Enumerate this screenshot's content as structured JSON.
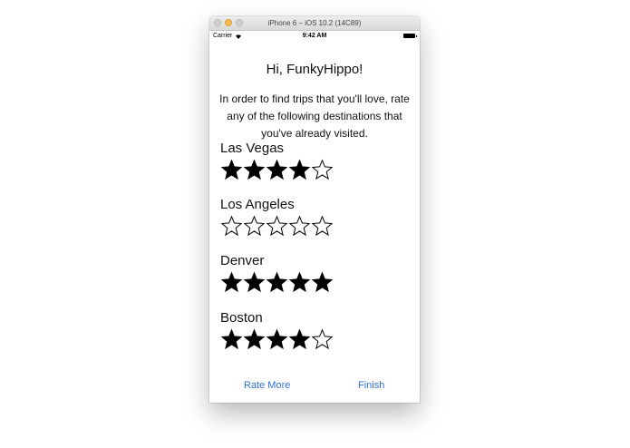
{
  "window": {
    "title": "iPhone 6 – iOS 10.2 (14C89)"
  },
  "statusbar": {
    "carrier": "Carrier",
    "time": "9:42 AM"
  },
  "main": {
    "greeting": "Hi, FunkyHippo!",
    "intro": "In order to find trips that you'll love, rate any of the following destinations that you've already visited."
  },
  "destinations": [
    {
      "name": "Las Vegas",
      "rating": 4,
      "max": 5
    },
    {
      "name": "Los Angeles",
      "rating": 0,
      "max": 5
    },
    {
      "name": "Denver",
      "rating": 5,
      "max": 5
    },
    {
      "name": "Boston",
      "rating": 4,
      "max": 5
    }
  ],
  "actions": {
    "rate_more": "Rate More",
    "finish": "Finish"
  },
  "colors": {
    "link": "#2f6fd6",
    "star": "#000000"
  }
}
